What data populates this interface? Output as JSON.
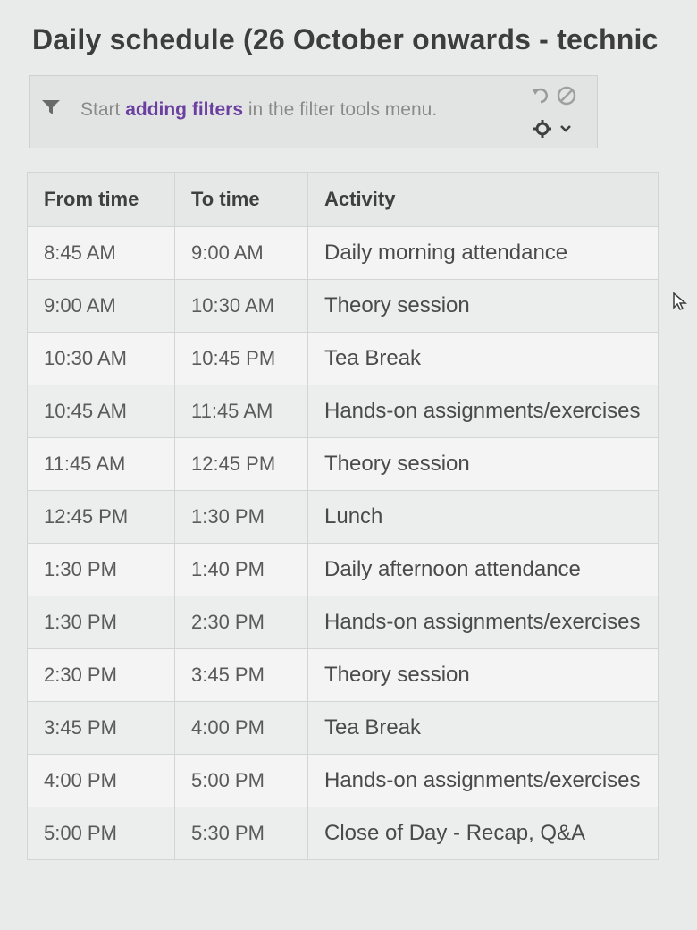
{
  "page": {
    "title": "Daily schedule  (26 October onwards - technic"
  },
  "filter_bar": {
    "text_before": "Start ",
    "link_label": "adding filters",
    "text_after": " in the filter tools menu.",
    "icons": [
      "filter-icon",
      "undo-icon",
      "clear-filter-icon",
      "gear-icon",
      "chevron-down-icon"
    ]
  },
  "table": {
    "headers": {
      "from": "From time",
      "to": "To time",
      "activity": "Activity"
    },
    "rows": [
      {
        "from": "8:45 AM",
        "to": "9:00 AM",
        "activity": "Daily morning attendance"
      },
      {
        "from": "9:00 AM",
        "to": "10:30 AM",
        "activity": "Theory session"
      },
      {
        "from": "10:30 AM",
        "to": "10:45 PM",
        "activity": "Tea Break"
      },
      {
        "from": "10:45 AM",
        "to": "11:45 AM",
        "activity": "Hands-on assignments/exercises"
      },
      {
        "from": "11:45 AM",
        "to": "12:45 PM",
        "activity": "Theory session"
      },
      {
        "from": "12:45 PM",
        "to": "1:30 PM",
        "activity": "Lunch"
      },
      {
        "from": "1:30 PM",
        "to": "1:40 PM",
        "activity": "Daily afternoon attendance"
      },
      {
        "from": "1:30 PM",
        "to": "2:30 PM",
        "activity": "Hands-on assignments/exercises"
      },
      {
        "from": "2:30 PM",
        "to": "3:45 PM",
        "activity": "Theory session"
      },
      {
        "from": "3:45 PM",
        "to": "4:00 PM",
        "activity": "Tea Break"
      },
      {
        "from": "4:00 PM",
        "to": "5:00 PM",
        "activity": "Hands-on assignments/exercises"
      },
      {
        "from": "5:00 PM",
        "to": "5:30 PM",
        "activity": "Close of Day - Recap, Q&A"
      }
    ]
  },
  "colors": {
    "background": "#e9ebea",
    "link": "#6b3fa0",
    "border": "#d3d5d4"
  }
}
